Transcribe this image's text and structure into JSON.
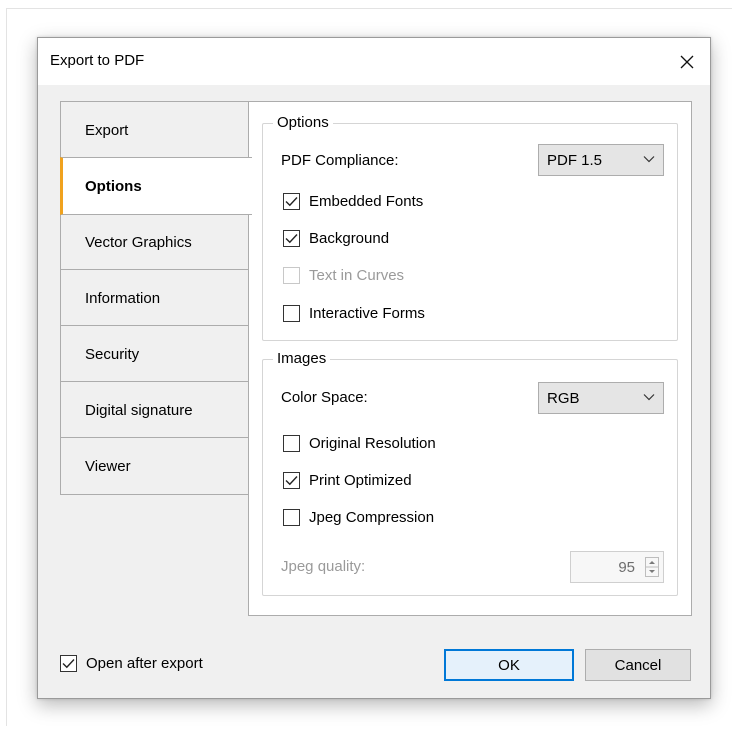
{
  "dialog": {
    "title": "Export to PDF"
  },
  "icons": {
    "close": "close-icon",
    "chevron": "chevron-down-icon",
    "check": "checkmark-icon",
    "spin": "spin-up-down-icon"
  },
  "colors": {
    "active_tab_accent": "#f0a21e",
    "default_button_border": "#0078d7"
  },
  "tabs": [
    {
      "label": "Export",
      "active": false
    },
    {
      "label": "Options",
      "active": true
    },
    {
      "label": "Vector Graphics",
      "active": false
    },
    {
      "label": "Information",
      "active": false
    },
    {
      "label": "Security",
      "active": false
    },
    {
      "label": "Digital signature",
      "active": false
    },
    {
      "label": "Viewer",
      "active": false
    }
  ],
  "options_group": {
    "legend": "Options",
    "compliance_label": "PDF Compliance:",
    "compliance_value": "PDF 1.5",
    "checkboxes": [
      {
        "label": "Embedded Fonts",
        "checked": true,
        "enabled": true
      },
      {
        "label": "Background",
        "checked": true,
        "enabled": true
      },
      {
        "label": "Text in Curves",
        "checked": false,
        "enabled": false
      },
      {
        "label": "Interactive Forms",
        "checked": false,
        "enabled": true
      }
    ]
  },
  "images_group": {
    "legend": "Images",
    "color_space_label": "Color Space:",
    "color_space_value": "RGB",
    "checkboxes": [
      {
        "label": "Original Resolution",
        "checked": false,
        "enabled": true
      },
      {
        "label": "Print Optimized",
        "checked": true,
        "enabled": true
      },
      {
        "label": "Jpeg Compression",
        "checked": false,
        "enabled": true
      }
    ],
    "jpeg_quality_label": "Jpeg quality:",
    "jpeg_quality_value": "95"
  },
  "footer": {
    "open_after_export_label": "Open after export",
    "open_after_export_checked": true,
    "ok_label": "OK",
    "cancel_label": "Cancel"
  }
}
